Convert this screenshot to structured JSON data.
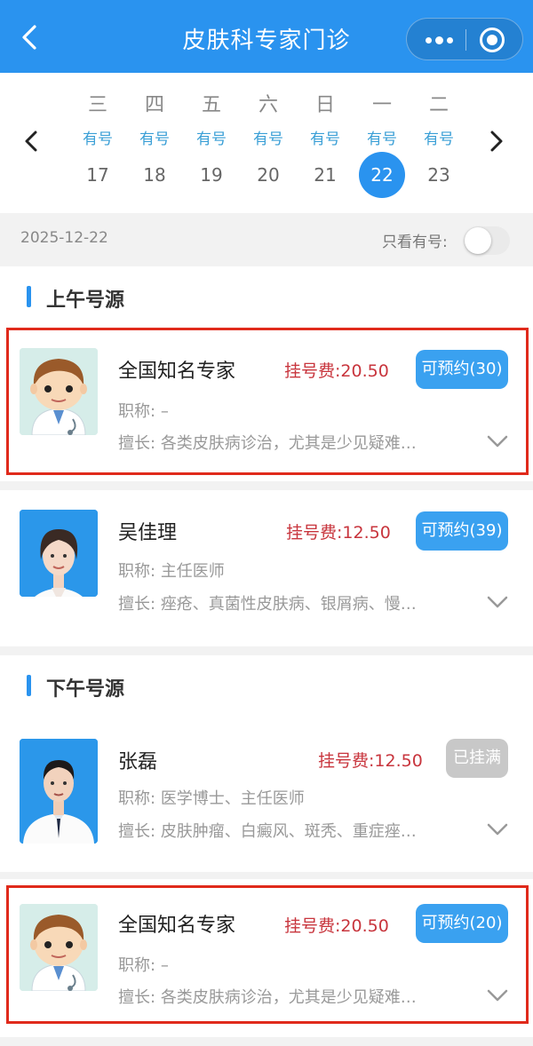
{
  "header": {
    "title": "皮肤科专家门诊",
    "back_icon": "chevron-left-icon",
    "more_icon": "more-dots-icon",
    "target_icon": "target-icon"
  },
  "calendar": {
    "days": [
      {
        "weekday": "三",
        "status": "有号",
        "date": "17"
      },
      {
        "weekday": "四",
        "status": "有号",
        "date": "18"
      },
      {
        "weekday": "五",
        "status": "有号",
        "date": "19"
      },
      {
        "weekday": "六",
        "status": "有号",
        "date": "20"
      },
      {
        "weekday": "日",
        "status": "有号",
        "date": "21"
      },
      {
        "weekday": "一",
        "status": "有号",
        "date": "22",
        "selected": true
      },
      {
        "weekday": "二",
        "status": "有号",
        "date": "23"
      }
    ]
  },
  "filter": {
    "date": "2025-12-22",
    "only_available_label": "只看有号:",
    "only_available_on": false
  },
  "sections": {
    "morning": {
      "title": "上午号源",
      "doctors": [
        {
          "name": "全国知名专家",
          "fee_label": "挂号费:",
          "fee": "20.50",
          "button": "可预约(30)",
          "title_label": "职称:",
          "title": "–",
          "specialty_label": "擅长:",
          "specialty": "各类皮肤病诊治，尤其是少见疑难…",
          "available": true,
          "highlighted": true
        },
        {
          "name": "吴佳理",
          "fee_label": "挂号费:",
          "fee": "12.50",
          "button": "可预约(39)",
          "title_label": "职称:",
          "title": "主任医师",
          "specialty_label": "擅长:",
          "specialty": "痤疮、真菌性皮肤病、银屑病、慢…",
          "available": true,
          "highlighted": false
        }
      ]
    },
    "afternoon": {
      "title": "下午号源",
      "doctors": [
        {
          "name": "张磊",
          "fee_label": "挂号费:",
          "fee": "12.50",
          "button": "已挂满",
          "title_label": "职称:",
          "title": "医学博士、主任医师",
          "specialty_label": "擅长:",
          "specialty": "皮肤肿瘤、白癜风、斑秃、重症痤…",
          "available": false,
          "highlighted": false
        },
        {
          "name": "全国知名专家",
          "fee_label": "挂号费:",
          "fee": "20.50",
          "button": "可预约(20)",
          "title_label": "职称:",
          "title": "–",
          "specialty_label": "擅长:",
          "specialty": "各类皮肤病诊治，尤其是少见疑难…",
          "available": true,
          "highlighted": true
        }
      ]
    }
  },
  "colors": {
    "primary": "#2a93ef",
    "fee": "#c8353d",
    "highlight_border": "#e02a1b",
    "full_button": "#c8c8c8"
  }
}
